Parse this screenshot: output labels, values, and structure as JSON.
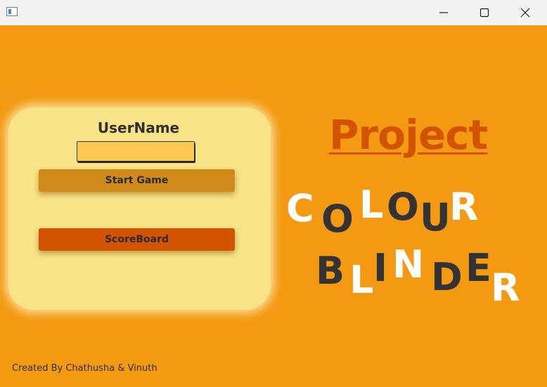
{
  "window": {
    "controls": {
      "minimize_icon": "minimize-icon",
      "maximize_icon": "maximize-icon",
      "close_icon": "close-icon"
    }
  },
  "login_card": {
    "username_label": "UserName",
    "username_value": "",
    "start_button": "Start Game",
    "scoreboard_button": "ScoreBoard"
  },
  "heading": {
    "project": "Project",
    "word1_letters": [
      "C",
      "O",
      "L",
      "O",
      "U",
      "R"
    ],
    "word2_letters": [
      "B",
      "L",
      "I",
      "N",
      "D",
      "E",
      "R"
    ]
  },
  "footer": {
    "credit": "Created By Chathusha & Vinuth"
  },
  "colors": {
    "background": "#f39a12",
    "card": "#f8e386",
    "input": "#ffc852",
    "start_button": "#d08a19",
    "scoreboard_button": "#d35400",
    "project_text": "#d35400",
    "letter_white": "#ffffff",
    "letter_dark": "#333333"
  }
}
